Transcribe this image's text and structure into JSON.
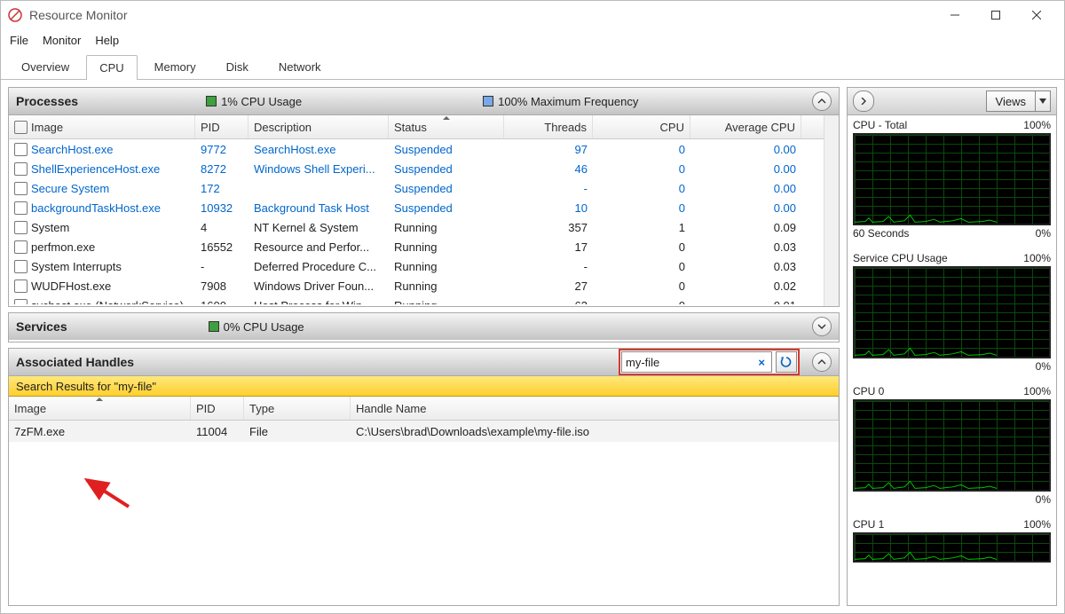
{
  "window": {
    "title": "Resource Monitor"
  },
  "menus": {
    "file": "File",
    "monitor": "Monitor",
    "help": "Help"
  },
  "tabs": {
    "overview": "Overview",
    "cpu": "CPU",
    "memory": "Memory",
    "disk": "Disk",
    "network": "Network"
  },
  "processes": {
    "title": "Processes",
    "usage_label": "1% CPU Usage",
    "freq_label": "100% Maximum Frequency",
    "headers": {
      "image": "Image",
      "pid": "PID",
      "desc": "Description",
      "status": "Status",
      "threads": "Threads",
      "cpu": "CPU",
      "avg": "Average CPU"
    },
    "rows": [
      {
        "image": "SearchHost.exe",
        "pid": "9772",
        "desc": "SearchHost.exe",
        "status": "Suspended",
        "threads": "97",
        "cpu": "0",
        "avg": "0.00",
        "blue": true
      },
      {
        "image": "ShellExperienceHost.exe",
        "pid": "8272",
        "desc": "Windows Shell Experi...",
        "status": "Suspended",
        "threads": "46",
        "cpu": "0",
        "avg": "0.00",
        "blue": true
      },
      {
        "image": "Secure System",
        "pid": "172",
        "desc": "",
        "status": "Suspended",
        "threads": "-",
        "cpu": "0",
        "avg": "0.00",
        "blue": true
      },
      {
        "image": "backgroundTaskHost.exe",
        "pid": "10932",
        "desc": "Background Task Host",
        "status": "Suspended",
        "threads": "10",
        "cpu": "0",
        "avg": "0.00",
        "blue": true
      },
      {
        "image": "System",
        "pid": "4",
        "desc": "NT Kernel & System",
        "status": "Running",
        "threads": "357",
        "cpu": "1",
        "avg": "0.09",
        "blue": false
      },
      {
        "image": "perfmon.exe",
        "pid": "16552",
        "desc": "Resource and Perfor...",
        "status": "Running",
        "threads": "17",
        "cpu": "0",
        "avg": "0.03",
        "blue": false
      },
      {
        "image": "System Interrupts",
        "pid": "-",
        "desc": "Deferred Procedure C...",
        "status": "Running",
        "threads": "-",
        "cpu": "0",
        "avg": "0.03",
        "blue": false
      },
      {
        "image": "WUDFHost.exe",
        "pid": "7908",
        "desc": "Windows Driver Foun...",
        "status": "Running",
        "threads": "27",
        "cpu": "0",
        "avg": "0.02",
        "blue": false
      },
      {
        "image": "svchost.exe (NetworkService)",
        "pid": "1600",
        "desc": "Host Process for Win...",
        "status": "Running",
        "threads": "63",
        "cpu": "0",
        "avg": "0.01",
        "blue": false
      }
    ]
  },
  "services": {
    "title": "Services",
    "usage_label": "0% CPU Usage"
  },
  "handles": {
    "title": "Associated Handles",
    "search_value": "my-file",
    "results_label": "Search Results for \"my-file\"",
    "headers": {
      "image": "Image",
      "pid": "PID",
      "type": "Type",
      "hname": "Handle Name"
    },
    "rows": [
      {
        "image": "7zFM.exe",
        "pid": "11004",
        "type": "File",
        "hname": "C:\\Users\\brad\\Downloads\\example\\my-file.iso"
      }
    ]
  },
  "right": {
    "views_label": "Views",
    "charts": [
      {
        "title": "CPU - Total",
        "tr": "100%",
        "bl": "60 Seconds",
        "br": "0%"
      },
      {
        "title": "Service CPU Usage",
        "tr": "100%",
        "bl": "",
        "br": "0%"
      },
      {
        "title": "CPU 0",
        "tr": "100%",
        "bl": "",
        "br": "0%"
      },
      {
        "title": "CPU 1",
        "tr": "100%",
        "bl": "",
        "br": ""
      }
    ]
  }
}
